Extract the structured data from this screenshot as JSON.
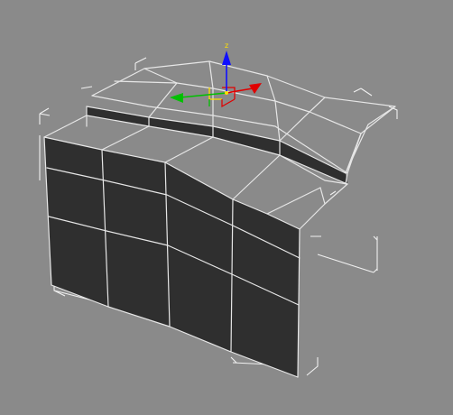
{
  "viewport": {
    "background_color": "#8a8a8a",
    "face_color": "#2f2f2f",
    "wire_color": "#e6e6e6",
    "selection_bracket_color": "#f0f0f0"
  },
  "gizmo": {
    "name": "move-transform-gizmo",
    "axes": [
      {
        "axis": "x",
        "color": "#e00000"
      },
      {
        "axis": "y",
        "color": "#00c000"
      },
      {
        "axis": "z",
        "color": "#1010ff"
      }
    ],
    "plane_handle_color": "#ffe000"
  },
  "object": {
    "type": "editable-poly-mesh",
    "selected": true,
    "front_grid": {
      "columns": 4,
      "rows": 3
    }
  }
}
